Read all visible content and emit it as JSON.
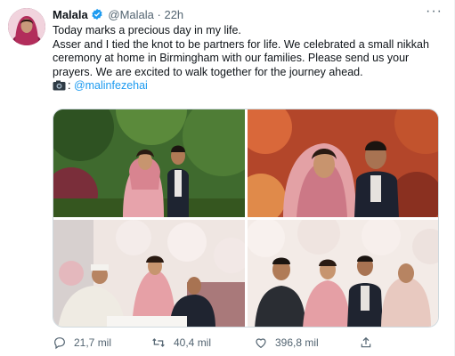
{
  "tweet": {
    "name": "Malala",
    "handle": "@Malala",
    "dot": "·",
    "time": "22h",
    "more_label": "···",
    "lines": [
      "Today marks a precious day in my life.",
      "Asser and I tied the knot to be partners for life. We celebrated a small nikkah ceremony at home in Birmingham with our families. Please send us your prayers. We are excited to walk together for the journey ahead."
    ],
    "credit_prefix": ": ",
    "credit_mention": "@malinfezehai",
    "icons": {
      "verified": "verified-badge-icon",
      "camera": "camera-icon"
    },
    "accent": "#1d9bf0"
  },
  "actions": {
    "replies": "21,7 mil",
    "retweets": "40,4 mil",
    "likes": "396,8 mil"
  }
}
